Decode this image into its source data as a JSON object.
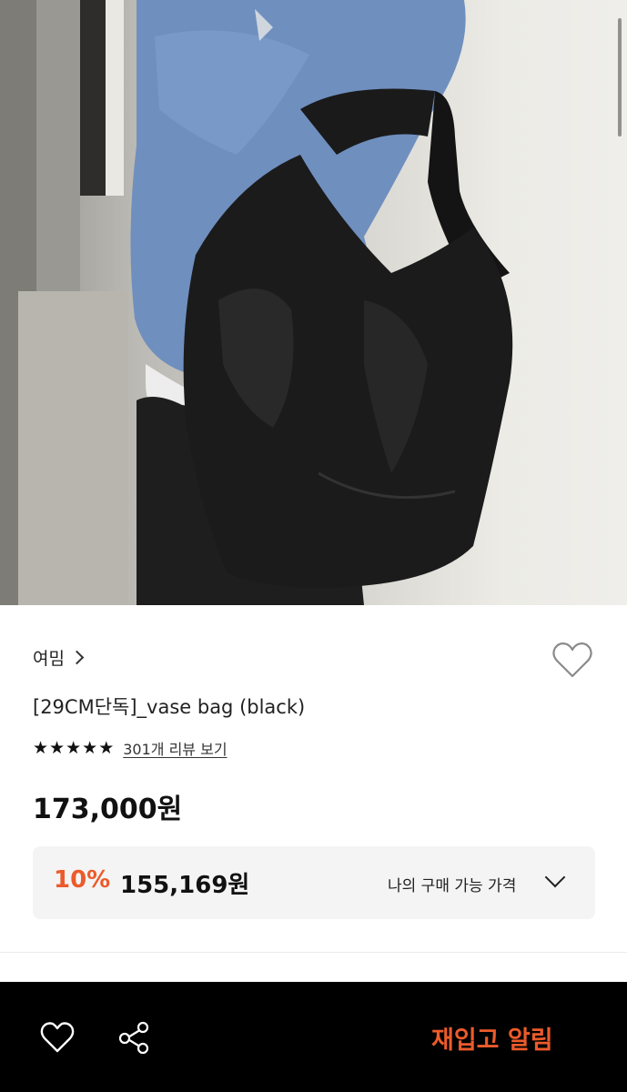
{
  "product_image": {
    "alt": "vase bag black worn on shoulder"
  },
  "brand": {
    "name": "여밈",
    "chevron_icon": "chevron-right-icon"
  },
  "wishlist": {
    "icon": "heart-outline-icon"
  },
  "product": {
    "title": "[29CM단독]_vase bag (black)",
    "rating_stars": 5,
    "review_link": "301개 리뷰 보기",
    "price": "173,000원"
  },
  "discount": {
    "percent": "10%",
    "price": "155,169원",
    "my_price_label": "나의 구매 가능 가격",
    "chevron_icon": "chevron-down-icon"
  },
  "bottom_bar": {
    "heart_icon": "heart-outline-icon",
    "share_icon": "share-icon",
    "restock_label": "재입고 알림"
  },
  "colors": {
    "accent": "#ec5b2b",
    "bar_bg": "#000000",
    "discount_bg": "#f4f4f4"
  }
}
